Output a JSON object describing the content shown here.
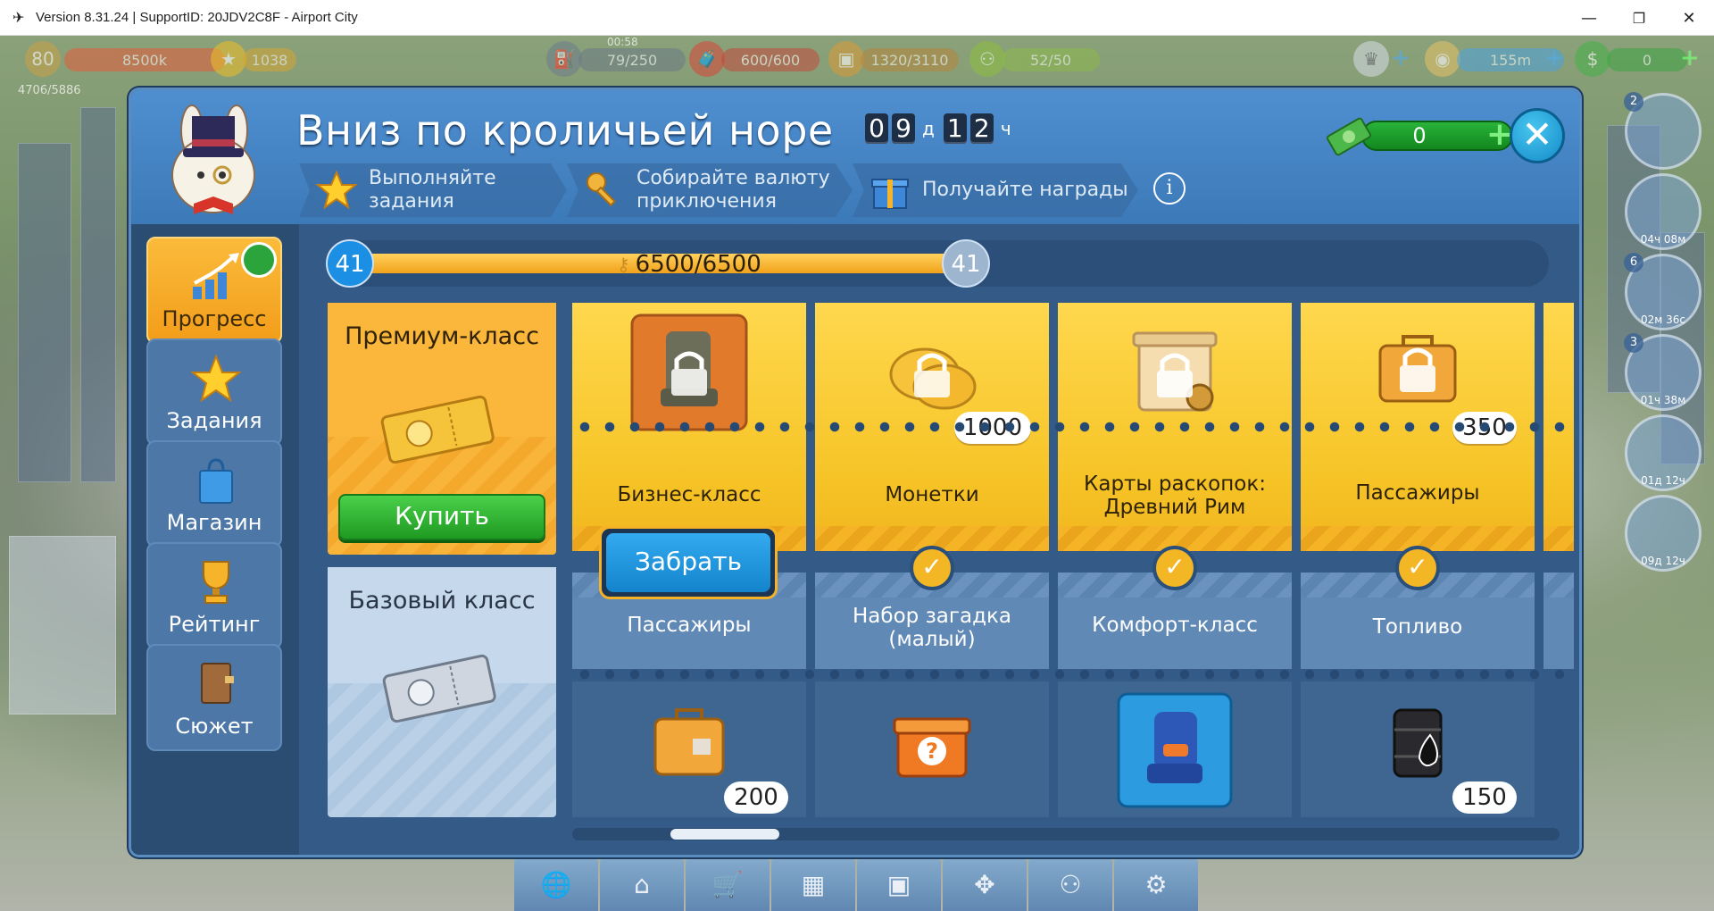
{
  "window": {
    "title": "Version 8.31.24 | SupportID: 20JDV2C8F - Airport City",
    "minimize": "—",
    "maximize": "❐",
    "close": "✕"
  },
  "hud": {
    "level": "80",
    "xp": "8500k",
    "stars": "1038",
    "fuel_timer": "00:58",
    "fuel": "79/250",
    "bags": "600/600",
    "cargo": "1320/3110",
    "staff": "52/50",
    "coins": "155m",
    "cash": "0",
    "population": "4706/5886"
  },
  "panel": {
    "title": "Вниз по кроличьей норе",
    "timer_days": [
      "0",
      "9"
    ],
    "timer_days_unit": "д",
    "timer_hours": [
      "1",
      "2"
    ],
    "timer_hours_unit": "ч",
    "cash_value": "0",
    "tabs": [
      {
        "label": "Выполняйте\nзадания",
        "icon": "star-icon"
      },
      {
        "label": "Собирайте валюту\nприключения",
        "icon": "key-icon"
      },
      {
        "label": "Получайте награды",
        "icon": "gift-icon"
      }
    ],
    "info": "i"
  },
  "sidebar": {
    "items": [
      {
        "label": "Прогресс",
        "icon": "progress-chart-icon",
        "active": true
      },
      {
        "label": "Задания",
        "icon": "star-icon",
        "active": false
      },
      {
        "label": "Магазин",
        "icon": "shopping-bag-icon",
        "active": false
      },
      {
        "label": "Рейтинг",
        "icon": "trophy-icon",
        "active": false
      },
      {
        "label": "Сюжет",
        "icon": "book-icon",
        "active": false
      }
    ]
  },
  "progress": {
    "level_left": "41",
    "level_right": "41",
    "text": "6500/6500",
    "fraction": 1.0
  },
  "premium": {
    "title": "Премиум-класс",
    "buy_label": "Купить"
  },
  "basic": {
    "title": "Базовый класс"
  },
  "rewards": [
    {
      "premium": {
        "name": "Бизнес-класс",
        "icon": "business-seat-locked-icon",
        "count": ""
      },
      "basic": {
        "name": "Пассажиры",
        "icon": "suitcase-icon",
        "count": "200"
      },
      "claim_label": "Забрать"
    },
    {
      "premium": {
        "name": "Монетки",
        "icon": "coins-locked-icon",
        "count": "1000"
      },
      "basic": {
        "name": "Набор загадка\n(малый)",
        "icon": "mystery-box-icon",
        "count": ""
      }
    },
    {
      "premium": {
        "name": "Карты раскопок:\nДревний Рим",
        "icon": "dig-cards-locked-icon",
        "count": ""
      },
      "basic": {
        "name": "Комфорт-класс",
        "icon": "comfort-seat-icon",
        "count": ""
      }
    },
    {
      "premium": {
        "name": "Пассажиры",
        "icon": "suitcase-locked-icon",
        "count": "350"
      },
      "basic": {
        "name": "Топливо",
        "icon": "fuel-barrel-icon",
        "count": "150"
      }
    }
  ],
  "right_timers": [
    {
      "num": "2",
      "label": ""
    },
    {
      "num": "",
      "label": "04ч 08м"
    },
    {
      "num": "6",
      "label": "02м 36с"
    },
    {
      "num": "3",
      "label": "01ч 38м"
    },
    {
      "num": "",
      "label": "01д 12ч"
    },
    {
      "num": "",
      "label": "09д 12ч"
    }
  ],
  "colors": {
    "panel": "#2c4d72",
    "header": "#3c79b8",
    "premium": "#f6c427",
    "basic": "#6189b6",
    "accent_orange": "#f29d1a",
    "buy_green": "#1f9a22",
    "claim_blue": "#1384cc"
  }
}
